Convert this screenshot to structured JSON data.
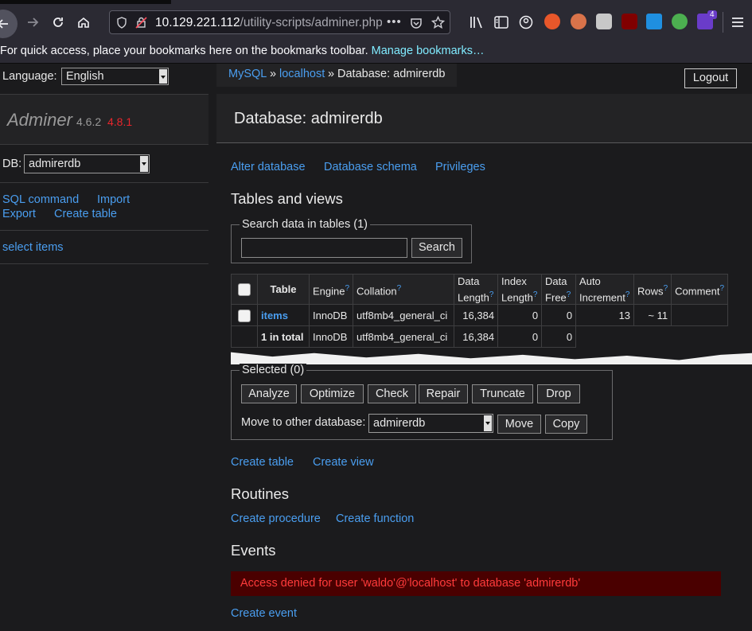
{
  "browser": {
    "url_host": "10.129.221.112",
    "url_path": "/utility-scripts/adminer.php",
    "bookmarks_text": "For quick access, place your bookmarks here on the bookmarks toolbar.",
    "manage_bookmarks": "Manage bookmarks…",
    "ext_badge": "4"
  },
  "sidebar": {
    "language_label": "Language:",
    "language_value": "English",
    "app_name": "Adminer",
    "version_current": "4.6.2",
    "version_new": "4.8.1",
    "db_label": "DB:",
    "db_value": "admirerdb",
    "links": {
      "sql_command": "SQL command",
      "import": "Import",
      "export": "Export",
      "create_table": "Create table",
      "select_items": "select items"
    }
  },
  "main": {
    "breadcrumb": {
      "mysql": "MySQL",
      "sep1": "»",
      "host": "localhost",
      "sep2": "»",
      "current": "Database: admirerdb"
    },
    "logout": "Logout",
    "title": "Database: admirerdb",
    "actions": {
      "alter": "Alter database",
      "schema": "Database schema",
      "privileges": "Privileges"
    },
    "tables_heading": "Tables and views",
    "search_legend": "Search data in tables (1)",
    "search_button": "Search",
    "table": {
      "headers": {
        "table": "Table",
        "engine": "Engine",
        "collation": "Collation",
        "data_length_1": "Data",
        "data_length_2": "Length",
        "index_length_1": "Index",
        "index_length_2": "Length",
        "data_free_1": "Data",
        "data_free_2": "Free",
        "auto_inc_1": "Auto",
        "auto_inc_2": "Increment",
        "rows": "Rows",
        "comment": "Comment",
        "help": "?"
      },
      "row": {
        "name": "items",
        "engine": "InnoDB",
        "collation": "utf8mb4_general_ci",
        "data_length": "16,384",
        "index_length": "0",
        "data_free": "0",
        "auto_increment": "13",
        "rows": "~ 11",
        "comment": ""
      },
      "total": {
        "name": "1 in total",
        "engine": "InnoDB",
        "collation": "utf8mb4_general_ci",
        "data_length": "16,384",
        "index_length": "0",
        "data_free": "0"
      }
    },
    "selected_legend": "Selected (0)",
    "selected_buttons": {
      "analyze": "Analyze",
      "optimize": "Optimize",
      "check": "Check",
      "repair": "Repair",
      "truncate": "Truncate",
      "drop": "Drop"
    },
    "move_label": "Move to other database:",
    "move_value": "admirerdb",
    "move_button": "Move",
    "copy_button": "Copy",
    "create_table": "Create table",
    "create_view": "Create view",
    "routines_heading": "Routines",
    "create_procedure": "Create procedure",
    "create_function": "Create function",
    "events_heading": "Events",
    "error": "Access denied for user 'waldo'@'localhost' to database 'admirerdb'",
    "create_event": "Create event"
  }
}
